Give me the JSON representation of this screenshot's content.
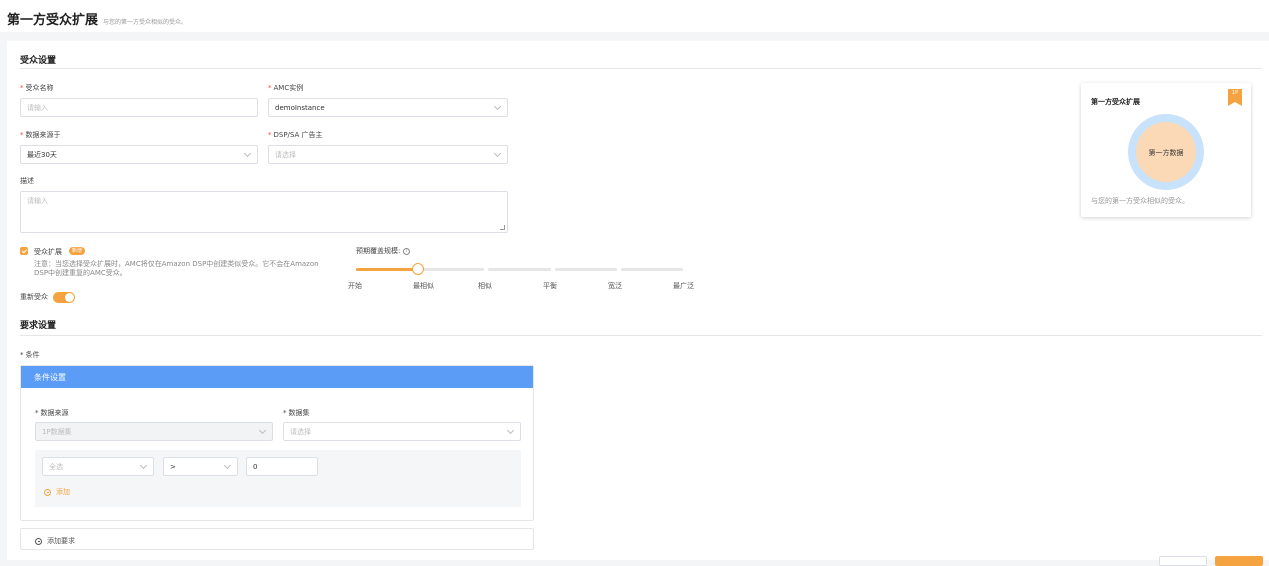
{
  "header": {
    "title": "第一方受众扩展",
    "subtitle": "与您的第一方受众相似的受众。"
  },
  "audience_settings": {
    "section_title": "受众设置",
    "name": {
      "label": "受众名称",
      "placeholder": "请输入"
    },
    "amc_instance": {
      "label": "AMC实例",
      "value": "demoInstance"
    },
    "data_source": {
      "label": "数据来源于",
      "value": "最近30天"
    },
    "advertiser": {
      "label": "DSP/SA 广告主",
      "placeholder": "请选择"
    },
    "description": {
      "label": "描述",
      "placeholder": "请输入"
    },
    "expansion": {
      "label": "受众扩展",
      "badge": "新增",
      "checked": true,
      "note_line1": "注意：当您选择受众扩展时，AMC将仅在Amazon DSP中创建类似受众。它不会在Amazon",
      "note_line2": "DSP中创建重复的AMC受众。"
    },
    "reach": {
      "label": "预期覆盖规模:",
      "info_icon": "i",
      "ticks": [
        "开始",
        "最相似",
        "相似",
        "平衡",
        "宽泛",
        "最广泛"
      ],
      "value_fraction": 0.19
    },
    "refresh": {
      "label": "重新受众",
      "on": true
    }
  },
  "requirement_settings": {
    "section_title": "要求设置",
    "condition_label": "条件",
    "panel": {
      "header": "条件设置",
      "source": {
        "label": "数据来源",
        "value": "1P数据集"
      },
      "dataset": {
        "label": "数据集",
        "placeholder": "请选择"
      },
      "rule": {
        "field": "全选",
        "operator": ">",
        "value": "0"
      },
      "add_label": "添加"
    },
    "add_requirement_label": "添加要求"
  },
  "preview": {
    "title": "第一方受众扩展",
    "bookmark": "1P",
    "center_label": "第一方数据",
    "caption": "与您的第一方受众相似的受众。"
  },
  "colors": {
    "accent": "#f5a341",
    "panel_header": "#5b9cf6",
    "ring": "#c9e2fb",
    "core": "#fbd9b6"
  }
}
